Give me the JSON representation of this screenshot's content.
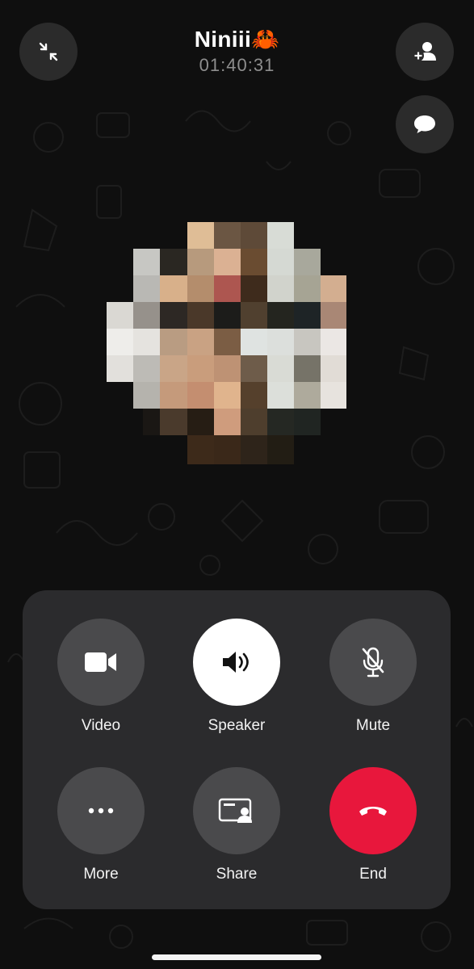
{
  "call": {
    "name": "Niniii",
    "name_emoji": "🦀",
    "timer": "01:40:31"
  },
  "top_actions": {
    "minimize_icon": "minimize-arrows-icon",
    "add_participant_icon": "add-person-icon",
    "chat_icon": "chat-bubble-icon"
  },
  "controls": {
    "video": {
      "label": "Video",
      "icon": "video-camera-icon"
    },
    "speaker": {
      "label": "Speaker",
      "icon": "speaker-icon",
      "active": true
    },
    "mute": {
      "label": "Mute",
      "icon": "microphone-off-icon"
    },
    "more": {
      "label": "More",
      "icon": "ellipsis-icon"
    },
    "share": {
      "label": "Share",
      "icon": "screen-share-icon"
    },
    "end": {
      "label": "End",
      "icon": "hang-up-icon"
    }
  },
  "colors": {
    "background": "#0f0f0f",
    "panel": "#2b2b2d",
    "button": "#4a4a4c",
    "active_button": "#ffffff",
    "end_button": "#e8173c",
    "timer_text": "#8e8e8e"
  }
}
